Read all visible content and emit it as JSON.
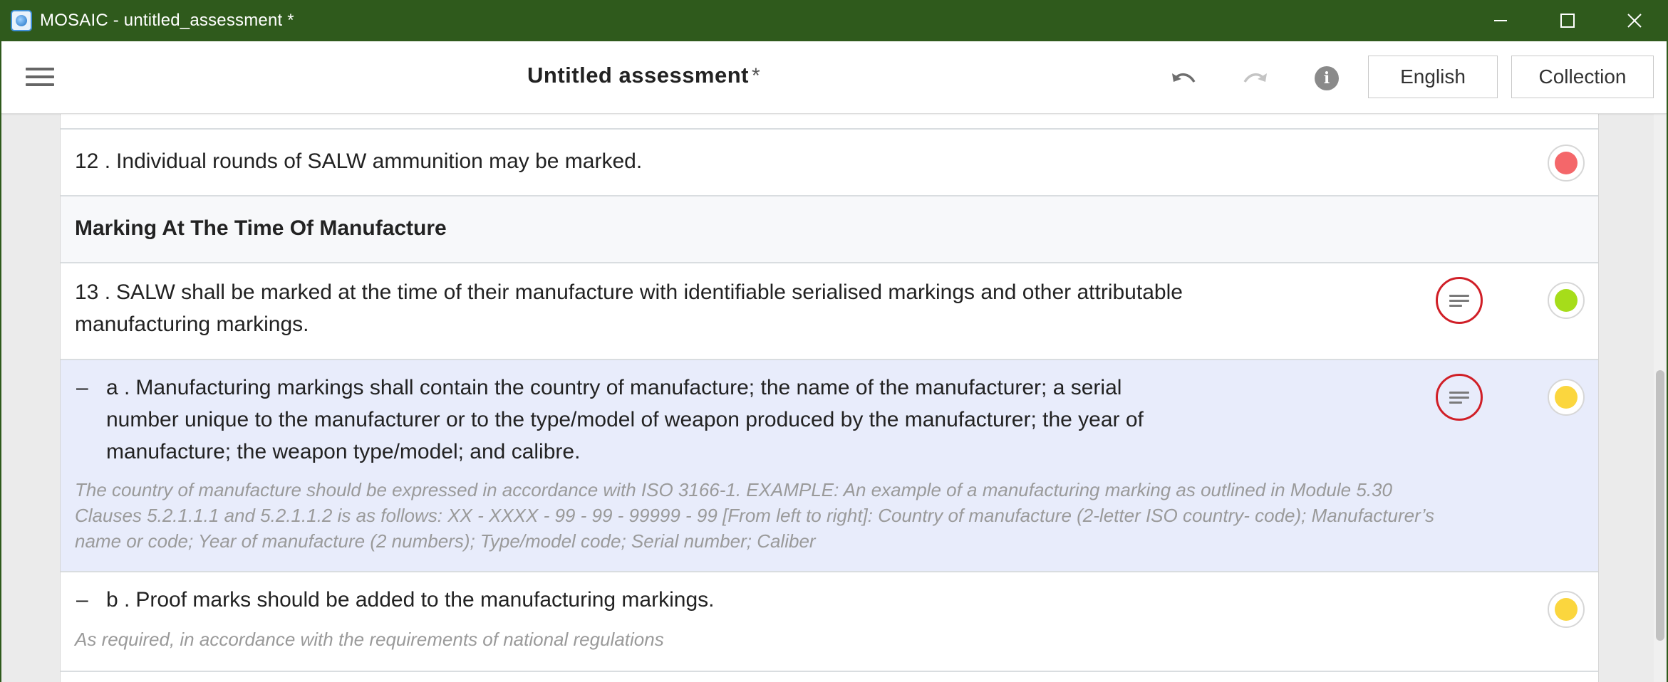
{
  "window": {
    "title": "MOSAIC - untitled_assessment *"
  },
  "header": {
    "title": "Untitled assessment",
    "unsaved_marker": "*",
    "language_label": "English",
    "collection_label": "Collection"
  },
  "content": {
    "row12": {
      "number": "12 .",
      "text": "Individual rounds of SALW ammunition may be marked.",
      "status_color": "#f4676a"
    },
    "section": {
      "title": "Marking At The Time Of Manufacture"
    },
    "row13": {
      "number": "13 .",
      "text_line1": "SALW shall be marked at the time of their manufacture with identifiable serialised markings and other attributable",
      "text_line2": "manufacturing markings.",
      "status_color": "#a6dd1a"
    },
    "row_a": {
      "dash": "–",
      "letter": "a .",
      "text_line1": "Manufacturing markings shall contain the country of manufacture; the name of the manufacturer; a serial",
      "text_line2": "number unique to the manufacturer or to the type/model of weapon produced by the manufacturer; the year of",
      "text_line3": "manufacture; the weapon type/model; and calibre.",
      "note_line1": "The country of manufacture should be expressed in accordance with ISO 3166-1. EXAMPLE: An example of a manufacturing marking as outlined in Module 5.30",
      "note_line2": "Clauses 5.2.1.1.1 and 5.2.1.1.2 is as follows: XX - XXXX - 99 - 99 - 99999 - 99 [From left to right]: Country of manufacture (2-letter ISO country- code); Manufacturer’s",
      "note_line3": "name or code; Year of manufacture (2 numbers); Type/model code; Serial number; Caliber",
      "status_color": "#fbd63e",
      "highlight_color": "#e8ecfb"
    },
    "row_b": {
      "dash": "–",
      "letter": "b .",
      "text": "Proof marks should be added to the manufacturing markings.",
      "note": "As required, in accordance with the requirements of national regulations",
      "status_color": "#fbd63e"
    }
  },
  "icons": {
    "app": "mosaic-app-icon",
    "menu": "hamburger-menu-icon",
    "undo": "undo-icon",
    "redo": "redo-icon",
    "info": "info-icon",
    "comment": "comment-lines-icon",
    "minimize": "minimize-icon",
    "maximize": "maximize-icon",
    "close": "close-icon"
  },
  "colors": {
    "titlebar": "#2f5a1c",
    "comment_ring": "#d01f27"
  }
}
